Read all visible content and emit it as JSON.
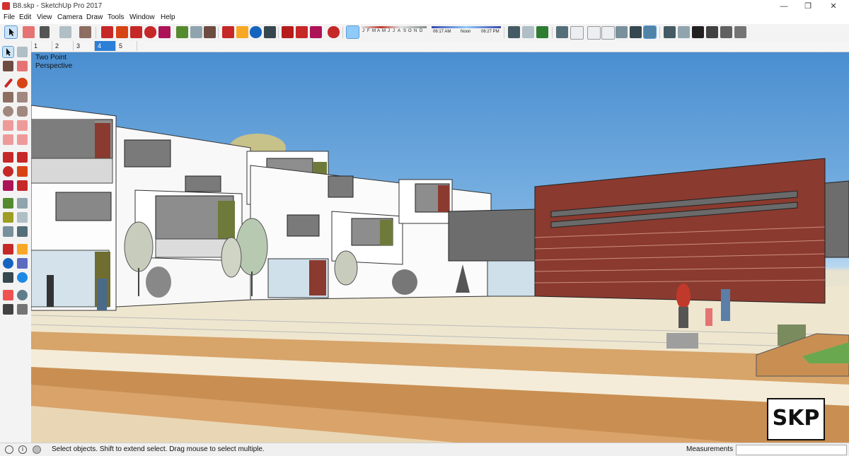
{
  "window": {
    "title": "B8.skp - SketchUp Pro 2017",
    "minimize": "—",
    "maximize": "❐",
    "close": "✕"
  },
  "menu": [
    "File",
    "Edit",
    "View",
    "Camera",
    "Draw",
    "Tools",
    "Window",
    "Help"
  ],
  "shadow": {
    "months": [
      "J",
      "F",
      "M",
      "A",
      "M",
      "J",
      "J",
      "A",
      "S",
      "O",
      "N",
      "D"
    ],
    "time_start": "06:17 AM",
    "time_mid": "Noon",
    "time_end": "06:27 PM"
  },
  "scenes": {
    "tabs": [
      "1",
      "2",
      "3",
      "4",
      "5"
    ],
    "active": "4"
  },
  "viewport": {
    "camera_label_line1": "Two Point",
    "camera_label_line2": "Perspective",
    "badge": "SKP"
  },
  "status": {
    "hint": "Select objects. Shift to extend select. Drag mouse to select multiple.",
    "measurements_label": "Measurements",
    "measurements_value": ""
  },
  "colors": {
    "sky_top": "#4a8ed0",
    "brick": "#8b3a2f",
    "accent_blue": "#2b7fd6",
    "wood": "#c9955f"
  }
}
